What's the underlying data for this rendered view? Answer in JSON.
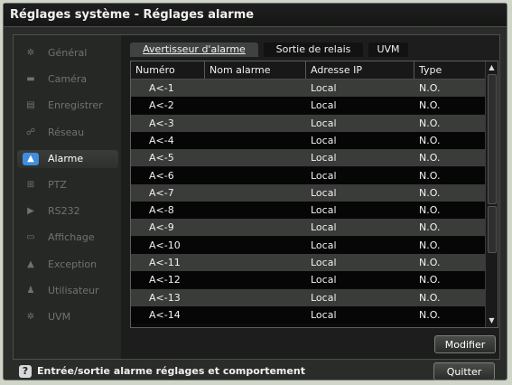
{
  "window": {
    "title": "Réglages système - Réglages alarme"
  },
  "sidebar": {
    "items": [
      {
        "label": "Général",
        "icon": "gear-icon",
        "glyph": "✲",
        "active": false
      },
      {
        "label": "Caméra",
        "icon": "camera-icon",
        "glyph": "▬",
        "active": false
      },
      {
        "label": "Enregistrer",
        "icon": "record-icon",
        "glyph": "▤",
        "active": false
      },
      {
        "label": "Réseau",
        "icon": "network-icon",
        "glyph": "☍",
        "active": false
      },
      {
        "label": "Alarme",
        "icon": "alarm-icon",
        "glyph": "▲",
        "active": true
      },
      {
        "label": "PTZ",
        "icon": "ptz-icon",
        "glyph": "⊞",
        "active": false
      },
      {
        "label": "RS232",
        "icon": "rs232-icon",
        "glyph": "▶",
        "active": false
      },
      {
        "label": "Affichage",
        "icon": "display-icon",
        "glyph": "▭",
        "active": false
      },
      {
        "label": "Exception",
        "icon": "exception-icon",
        "glyph": "▲",
        "active": false
      },
      {
        "label": "Utilisateur",
        "icon": "user-icon",
        "glyph": "♟",
        "active": false
      },
      {
        "label": "UVM",
        "icon": "uvm-icon",
        "glyph": "✲",
        "active": false
      }
    ]
  },
  "tabs": [
    {
      "label": "Avertisseur d'alarme",
      "active": true
    },
    {
      "label": "Sortie de relais",
      "active": false
    },
    {
      "label": "UVM",
      "active": false
    }
  ],
  "table": {
    "columns": [
      "Numéro",
      "Nom alarme",
      "Adresse IP",
      "Type"
    ],
    "rows": [
      [
        "A<-1",
        "",
        "Local",
        "N.O."
      ],
      [
        "A<-2",
        "",
        "Local",
        "N.O."
      ],
      [
        "A<-3",
        "",
        "Local",
        "N.O."
      ],
      [
        "A<-4",
        "",
        "Local",
        "N.O."
      ],
      [
        "A<-5",
        "",
        "Local",
        "N.O."
      ],
      [
        "A<-6",
        "",
        "Local",
        "N.O."
      ],
      [
        "A<-7",
        "",
        "Local",
        "N.O."
      ],
      [
        "A<-8",
        "",
        "Local",
        "N.O."
      ],
      [
        "A<-9",
        "",
        "Local",
        "N.O."
      ],
      [
        "A<-10",
        "",
        "Local",
        "N.O."
      ],
      [
        "A<-11",
        "",
        "Local",
        "N.O."
      ],
      [
        "A<-12",
        "",
        "Local",
        "N.O."
      ],
      [
        "A<-13",
        "",
        "Local",
        "N.O."
      ],
      [
        "A<-14",
        "",
        "Local",
        "N.O."
      ]
    ]
  },
  "buttons": {
    "modify": "Modifier",
    "quit": "Quitter"
  },
  "footer": {
    "help_text": "Entrée/sortie alarme réglages et comportement",
    "help_glyph": "?"
  },
  "colors": {
    "accent": "#3f8de0",
    "odd_row": "#3a3c39",
    "even_row": "#060606"
  }
}
